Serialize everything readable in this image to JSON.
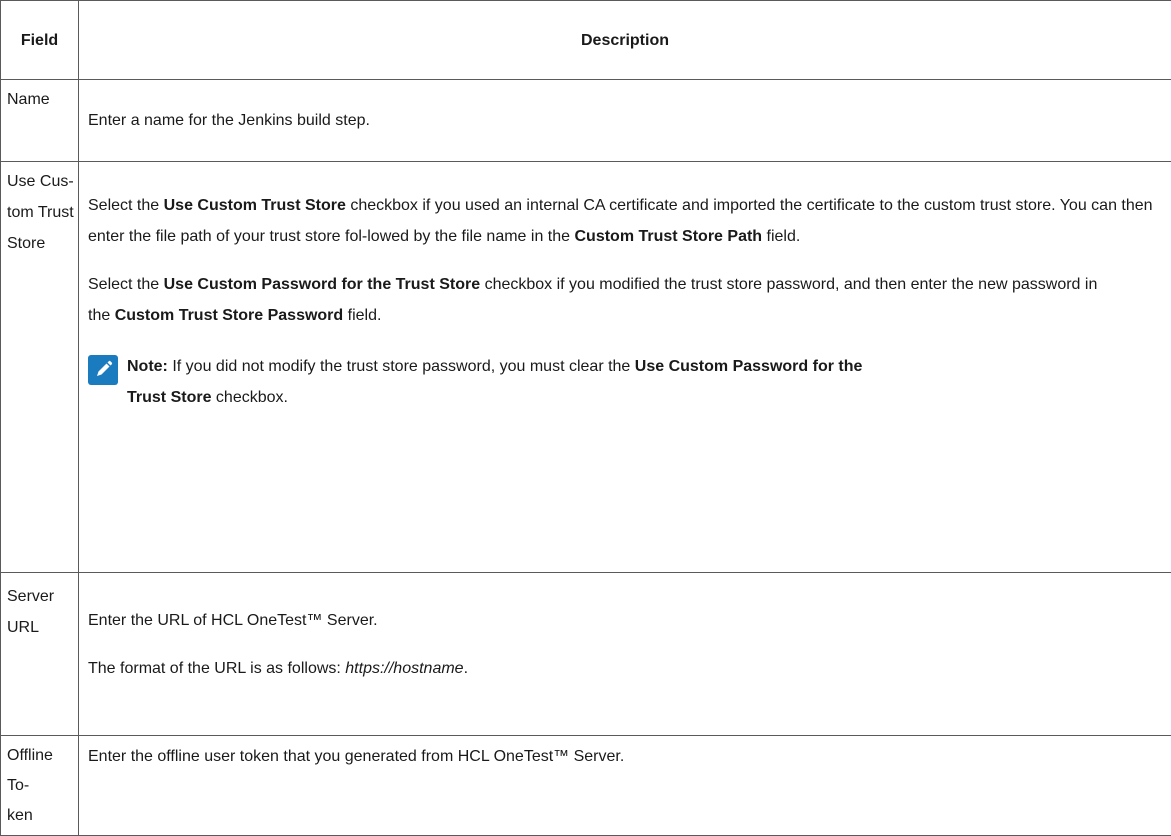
{
  "header": {
    "field": "Field",
    "description": "Description"
  },
  "rows": [
    {
      "field_lines": [
        "Name"
      ],
      "desc": {
        "text": "Enter a name for the Jenkins build step."
      }
    },
    {
      "field_lines": [
        "Use Cus-",
        "tom Trust",
        "Store"
      ],
      "para1": {
        "t1": "Select the ",
        "b1": "Use Custom Trust Store",
        "t2": " checkbox if you used an internal CA certificate and imported the certificate to the custom trust store. You can then enter the file path of your trust store fol-lowed by the file name in the ",
        "b2": "Custom Trust Store Path",
        "t3": " field."
      },
      "para2": {
        "t1": "Select the ",
        "b1": "Use Custom Password for the Trust Store",
        "t2": " checkbox if you modified the trust store password, and then enter the new password in the ",
        "b2": "Custom Trust Store Password",
        "t3": " field."
      },
      "note": {
        "icon": "pencil-icon",
        "label": "Note:",
        "t1": " If you did not modify the trust store password, you must clear the ",
        "b1": "Use Custom Password for the Trust Store",
        "t2": " checkbox."
      }
    },
    {
      "field_lines": [
        "Server",
        "URL"
      ],
      "para1": {
        "text": "Enter the URL of HCL OneTest™ Server."
      },
      "para2": {
        "t1": "The format of the URL is as follows: ",
        "i1": "https://hostname",
        "t2": "."
      }
    },
    {
      "field_lines": [
        "Offline To-",
        "ken"
      ],
      "desc": {
        "text": "Enter the offline user token that you generated from HCL OneTest™ Server."
      }
    }
  ],
  "colors": {
    "border": "#5a5a5a",
    "note_icon_bg": "#1b7bbf"
  }
}
